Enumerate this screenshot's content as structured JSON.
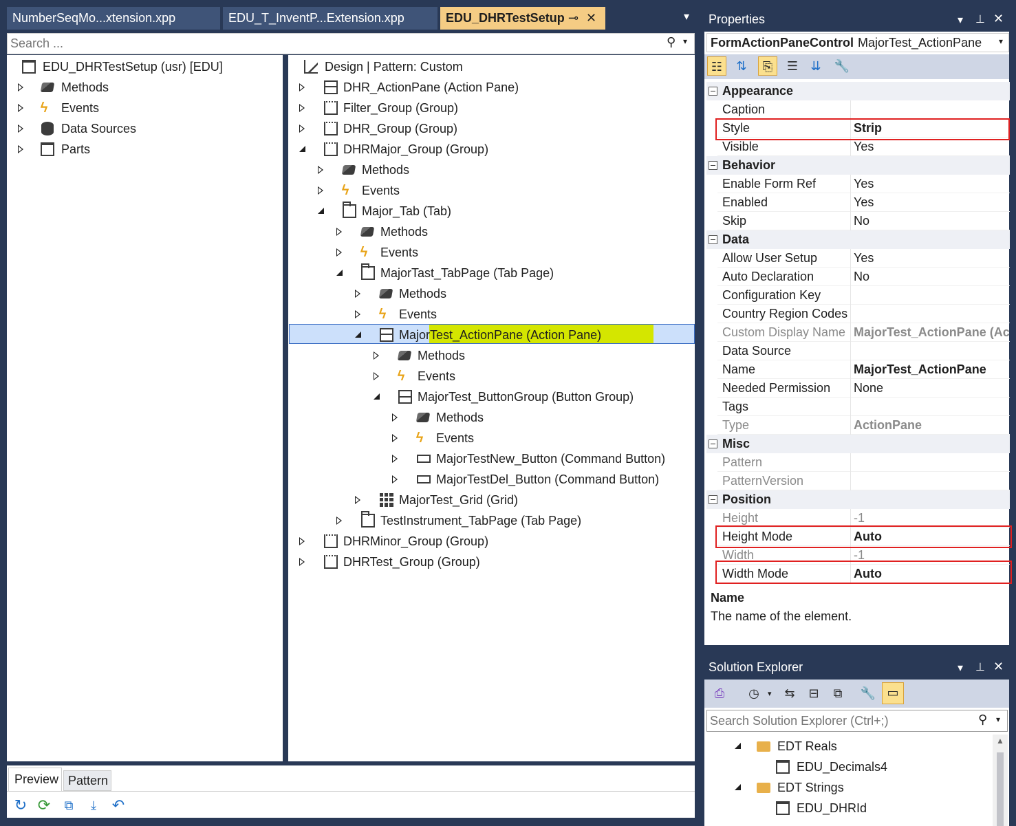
{
  "tabs": [
    {
      "label": "NumberSeqMo...xtension.xpp"
    },
    {
      "label": "EDU_T_InventP...Extension.xpp"
    },
    {
      "label": "EDU_DHRTestSetup"
    }
  ],
  "tab_controls": {
    "pin": "⊸",
    "close": "✕",
    "overflow": "▾"
  },
  "search": {
    "placeholder": "Search ..."
  },
  "left_tree": {
    "root": "EDU_DHRTestSetup (usr) [EDU]",
    "items": [
      "Methods",
      "Events",
      "Data Sources",
      "Parts"
    ]
  },
  "design_tree": {
    "root": "Design | Pattern: Custom",
    "items": [
      "DHR_ActionPane (Action Pane)",
      "Filter_Group (Group)",
      "DHR_Group (Group)",
      "DHRMajor_Group (Group)",
      "Methods",
      "Events",
      "Major_Tab (Tab)",
      "Methods",
      "Events",
      "MajorTast_TabPage (Tab Page)",
      "Methods",
      "Events",
      "MajorTest_ActionPane (Action Pane)",
      "Methods",
      "Events",
      "MajorTest_ButtonGroup (Button Group)",
      "Methods",
      "Events",
      "MajorTestNew_Button (Command Button)",
      "MajorTestDel_Button (Command Button)",
      "MajorTest_Grid (Grid)",
      "TestInstrument_TabPage (Tab Page)",
      "DHRMinor_Group (Group)",
      "DHRTest_Group (Group)"
    ]
  },
  "bottom_tabs": {
    "preview": "Preview",
    "pattern": "Pattern"
  },
  "properties": {
    "title": "Properties",
    "object_type": "FormActionPaneControl",
    "object_name": "MajorTest_ActionPane",
    "categories": {
      "appearance": "Appearance",
      "behavior": "Behavior",
      "data": "Data",
      "misc": "Misc",
      "position": "Position"
    },
    "rows": {
      "caption": {
        "name": "Caption",
        "value": ""
      },
      "style": {
        "name": "Style",
        "value": "Strip"
      },
      "visible": {
        "name": "Visible",
        "value": "Yes"
      },
      "enable_form_ref": {
        "name": "Enable Form Ref",
        "value": "Yes"
      },
      "enabled": {
        "name": "Enabled",
        "value": "Yes"
      },
      "skip": {
        "name": "Skip",
        "value": "No"
      },
      "allow_user_setup": {
        "name": "Allow User Setup",
        "value": "Yes"
      },
      "auto_declaration": {
        "name": "Auto Declaration",
        "value": "No"
      },
      "configuration_key": {
        "name": "Configuration Key",
        "value": ""
      },
      "country_region_codes": {
        "name": "Country Region Codes",
        "value": ""
      },
      "custom_display_name": {
        "name": "Custom Display Name",
        "value": "MajorTest_ActionPane (Act"
      },
      "data_source": {
        "name": "Data Source",
        "value": ""
      },
      "name": {
        "name": "Name",
        "value": "MajorTest_ActionPane"
      },
      "needed_permission": {
        "name": "Needed Permission",
        "value": "None"
      },
      "tags": {
        "name": "Tags",
        "value": ""
      },
      "type": {
        "name": "Type",
        "value": "ActionPane"
      },
      "pattern": {
        "name": "Pattern",
        "value": ""
      },
      "pattern_version": {
        "name": "PatternVersion",
        "value": ""
      },
      "height": {
        "name": "Height",
        "value": "-1"
      },
      "height_mode": {
        "name": "Height Mode",
        "value": "Auto"
      },
      "width": {
        "name": "Width",
        "value": "-1"
      },
      "width_mode": {
        "name": "Width Mode",
        "value": "Auto"
      }
    },
    "description": {
      "title": "Name",
      "text": "The name of the element."
    }
  },
  "solution_explorer": {
    "title": "Solution Explorer",
    "search_placeholder": "Search Solution Explorer (Ctrl+;)",
    "items": [
      "EDT Reals",
      "EDU_Decimals4",
      "EDT Strings",
      "EDU_DHRId"
    ]
  },
  "colors": {
    "chrome": "#293956",
    "active_tab": "#f5cc84",
    "selection": "#cce0fb",
    "highlight": "#d4e600",
    "red_box": "#e02020"
  }
}
